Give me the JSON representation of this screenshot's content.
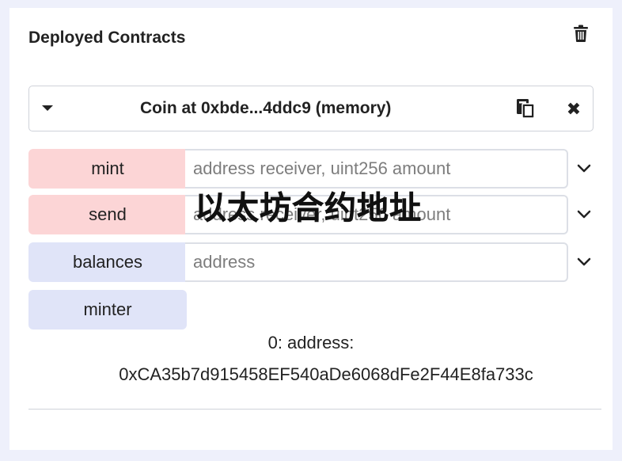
{
  "panel": {
    "title": "Deployed Contracts",
    "trash_icon": "trash-icon"
  },
  "contract": {
    "name": "Coin at 0xbde...4ddc9 (memory)",
    "icons": [
      "caret-down-icon",
      "copy-icon",
      "close-icon"
    ]
  },
  "functions": [
    {
      "label": "mint",
      "kind": "transact",
      "placeholder": "address receiver, uint256 amount"
    },
    {
      "label": "send",
      "kind": "transact",
      "placeholder": "address receiver, uint256 amount"
    },
    {
      "label": "balances",
      "kind": "call",
      "placeholder": "address"
    },
    {
      "label": "minter",
      "kind": "call"
    }
  ],
  "result": {
    "label": "0: address:",
    "value": "0xCA35b7d915458EF540aDe6068dFe2F44E8fa733c"
  },
  "overlay_text": "以太坊合约地址",
  "colors": {
    "transact": "#fcd5d6",
    "call": "#e0e4f8",
    "background": "#eef0fb"
  }
}
